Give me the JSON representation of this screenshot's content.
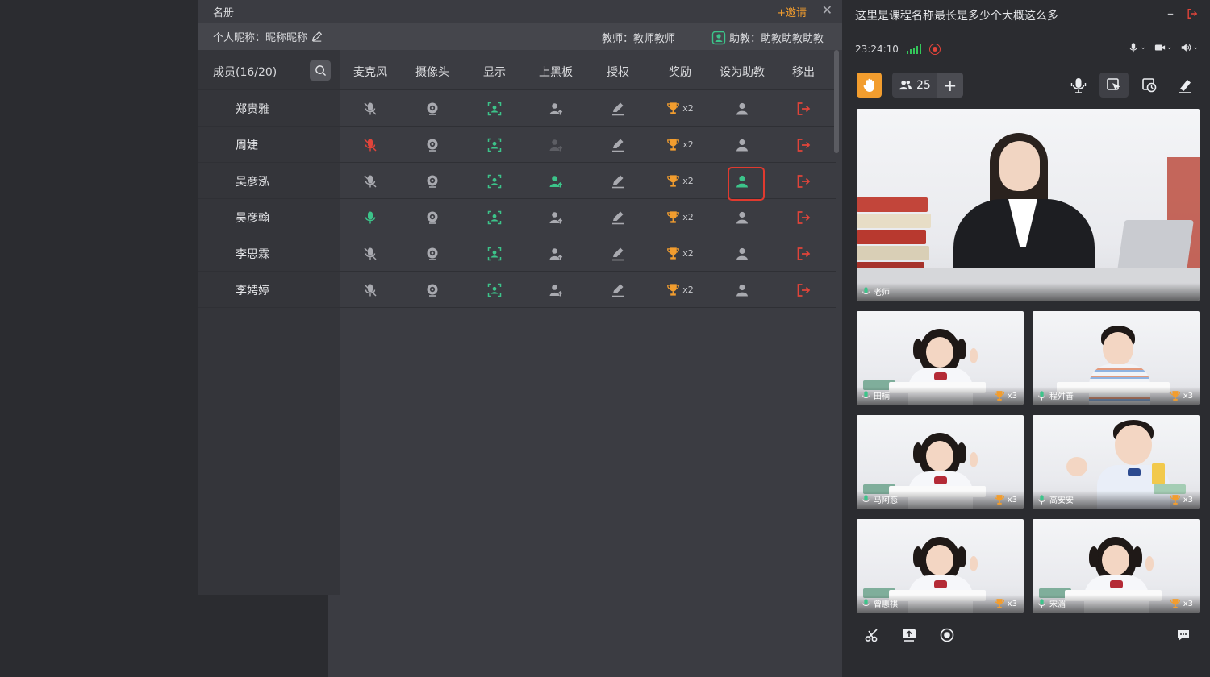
{
  "roster": {
    "title": "名册",
    "invite_label": "+邀请",
    "close_label": "✕",
    "nickname_label": "个人昵称：昵称昵称",
    "teacher_label": "教师：教师教师",
    "assistant_label": "助教：助教助教助教",
    "members_label": "成员(16/20)",
    "columns": [
      "麦克风",
      "摄像头",
      "显示",
      "上黑板",
      "授权",
      "奖励",
      "设为助教",
      "移出"
    ],
    "rows": [
      {
        "name": "郑贵雅",
        "mic": "off",
        "blackboard": "on",
        "reward": "x2",
        "assistant": "off"
      },
      {
        "name": "周婕",
        "mic": "off-red",
        "blackboard": "disabled",
        "reward": "x2",
        "assistant": "off"
      },
      {
        "name": "吴彦泓",
        "mic": "off",
        "blackboard": "active",
        "reward": "x2",
        "assistant": "active"
      },
      {
        "name": "吴彦翰",
        "mic": "on",
        "blackboard": "on",
        "reward": "x2",
        "assistant": "off"
      },
      {
        "name": "李思霖",
        "mic": "off",
        "blackboard": "on",
        "reward": "x2",
        "assistant": "off"
      },
      {
        "name": "李娉婷",
        "mic": "off",
        "blackboard": "on",
        "reward": "x2",
        "assistant": "off"
      }
    ]
  },
  "classroom": {
    "title": "这里是课程名称最长是多少个大概这么多",
    "minimize_label": "–",
    "time": "23:24:10",
    "student_count": "25",
    "plus_label": "+",
    "teacher_caption": "老师",
    "students": [
      {
        "name": "田楠",
        "reward": "x3"
      },
      {
        "name": "程舛善",
        "reward": "x3"
      },
      {
        "name": "马阿恋",
        "reward": "x3"
      },
      {
        "name": "高安安",
        "reward": "x3"
      },
      {
        "name": "曾惠祺",
        "reward": "x3"
      },
      {
        "name": "宋湄",
        "reward": "x3"
      }
    ]
  },
  "colors": {
    "accent_orange": "#f29d2e",
    "active_green": "#3cc48a",
    "danger_red": "#e0443a",
    "icon_gray": "#a9aab0"
  },
  "icons": {
    "mic": "microphone-icon",
    "camera": "camera-icon",
    "display": "display-icon",
    "blackboard": "user-up-icon",
    "authorize": "pencil-icon",
    "reward": "trophy-icon",
    "assistant": "user-icon",
    "remove": "exit-icon"
  }
}
